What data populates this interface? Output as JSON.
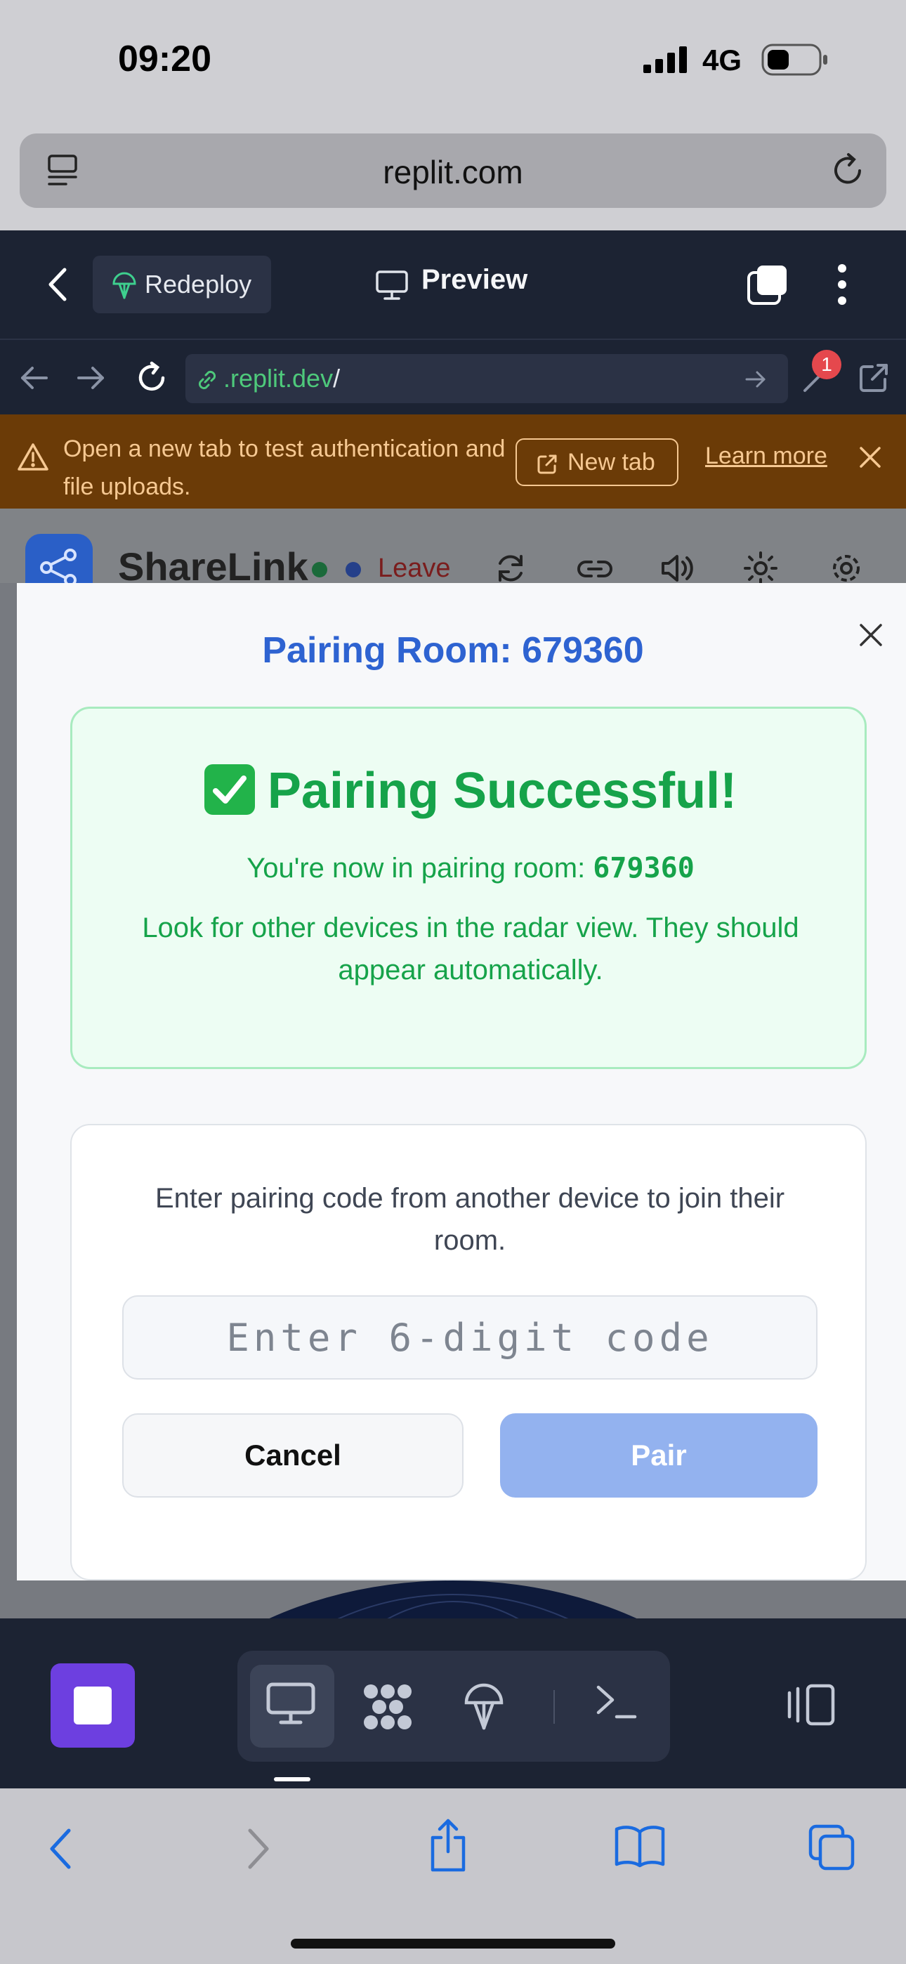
{
  "status_bar": {
    "time": "09:20",
    "network": "4G"
  },
  "browser": {
    "address": "replit.com"
  },
  "replit_header": {
    "redeploy_label": "Redeploy",
    "preview_label": "Preview"
  },
  "replit_url": {
    "url": ".replit.dev",
    "url_suffix": "/",
    "badge_count": "1"
  },
  "banner": {
    "message": "Open a new tab to test authentication and file uploads.",
    "new_tab_label": "New tab",
    "learn_more_label": "Learn more"
  },
  "app_header": {
    "title": "ShareLink",
    "leave_label": "Leave"
  },
  "modal": {
    "title": "Pairing Room: 679360",
    "success": {
      "title": "Pairing Successful!",
      "room_prefix": "You're now in pairing room: ",
      "room_code": "679360",
      "description": "Look for other devices in the radar view. They should appear automatically."
    },
    "pair": {
      "description": "Enter pairing code from another device to join their room.",
      "input_placeholder": "Enter 6-digit code",
      "input_value": "",
      "cancel_label": "Cancel",
      "pair_label": "Pair"
    }
  },
  "colors": {
    "accent_blue": "#2e63d1",
    "success_green": "#16a34a",
    "stop_purple": "#6d3fe0",
    "replit_bg": "#1c2333",
    "banner_bg": "#6b3b07"
  },
  "icons": {
    "status": [
      "signal-icon",
      "battery-icon"
    ],
    "browser": [
      "reader-icon",
      "reload-icon"
    ],
    "replit_header": [
      "back-chevron-icon",
      "redeploy-icon",
      "preview-monitor-icon",
      "tabs-icon",
      "more-vertical-icon"
    ],
    "replit_url": [
      "back-arrow-icon",
      "forward-arrow-icon",
      "reload-icon",
      "link-icon",
      "go-arrow-icon",
      "wrench-icon",
      "external-link-icon"
    ],
    "banner": [
      "warning-icon",
      "external-link-icon",
      "close-icon"
    ],
    "toolbar": [
      "stop-icon",
      "monitor-icon",
      "apps-icon",
      "deploy-icon",
      "terminal-icon",
      "panel-icon"
    ],
    "safari": [
      "back-icon",
      "forward-icon",
      "share-icon",
      "bookmarks-icon",
      "tabs-icon"
    ]
  }
}
